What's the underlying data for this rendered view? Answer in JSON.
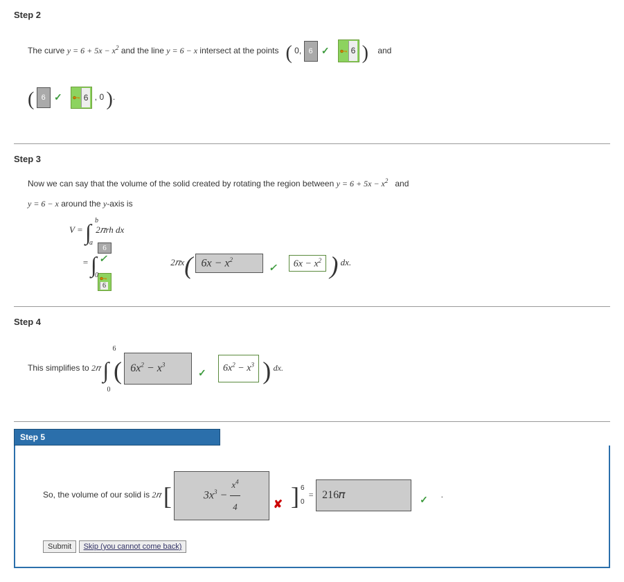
{
  "step2": {
    "header": "Step 2",
    "text_before_eq": "The curve ",
    "eq1": "y = 6 + 5x − x",
    "eq1_sup": "2",
    "text_mid1": " and the line ",
    "eq2": "y = 6 − x",
    "text_mid2": " intersect at the points ",
    "pt1_open": "(",
    "pt1_x": "0,",
    "pt1_y_input": "6",
    "pt1_key": "6",
    "pt1_close": ")",
    "and": "and",
    "pt2_open": "(",
    "pt2_x_input": "6",
    "pt2_key": "6",
    "pt2_after": ", 0",
    "pt2_close": ")."
  },
  "step3": {
    "header": "Step 3",
    "line1_a": "Now we can say that the volume of the solid created by rotating the region between  ",
    "line1_eq1": "y = 6 + 5x − x",
    "line1_sup": "2",
    "line1_and": " and",
    "line2_eq": "y = 6 − x",
    "line2_after": " around the ",
    "line2_yaxis": "y",
    "line2_axis_text": "-axis is",
    "formula1_V": "V  = ",
    "formula1_int_a": "a",
    "formula1_int_b": "b",
    "formula1_body": "2𝜋rh dx",
    "formula2_eq": " = ",
    "formula2_int_top_input": "6",
    "formula2_int_top_key": "6",
    "formula2_int_bot": "0",
    "formula2_coeff": "2𝜋x",
    "formula2_input": "6x − x",
    "formula2_input_sup": "2",
    "formula2_answer": "6x − x",
    "formula2_answer_sup": "2",
    "formula2_dx": "dx."
  },
  "step4": {
    "header": "Step 4",
    "text": "This simplifies to ",
    "coeff": "2𝜋",
    "int_top": "6",
    "int_bot": "0",
    "input": "6x",
    "input_sup1": "2",
    "input_mid": " − x",
    "input_sup2": "3",
    "answer": "6x",
    "answer_sup1": "2",
    "answer_mid": " − x",
    "answer_sup2": "3",
    "dx": "dx."
  },
  "step5": {
    "header": "Step 5",
    "text": "So, the volume of our solid is ",
    "coeff": "2𝜋",
    "bracket_a": "3x",
    "bracket_a_sup": "3",
    "bracket_minus": " −  ",
    "frac_num": "x",
    "frac_num_sup": "4",
    "frac_den": "4",
    "limits_top": "6",
    "limits_bot": "0",
    "eq": " = ",
    "result_input": "216𝜋",
    "dot": ".",
    "submit": "Submit",
    "skip": "Skip (you cannot come back)"
  }
}
